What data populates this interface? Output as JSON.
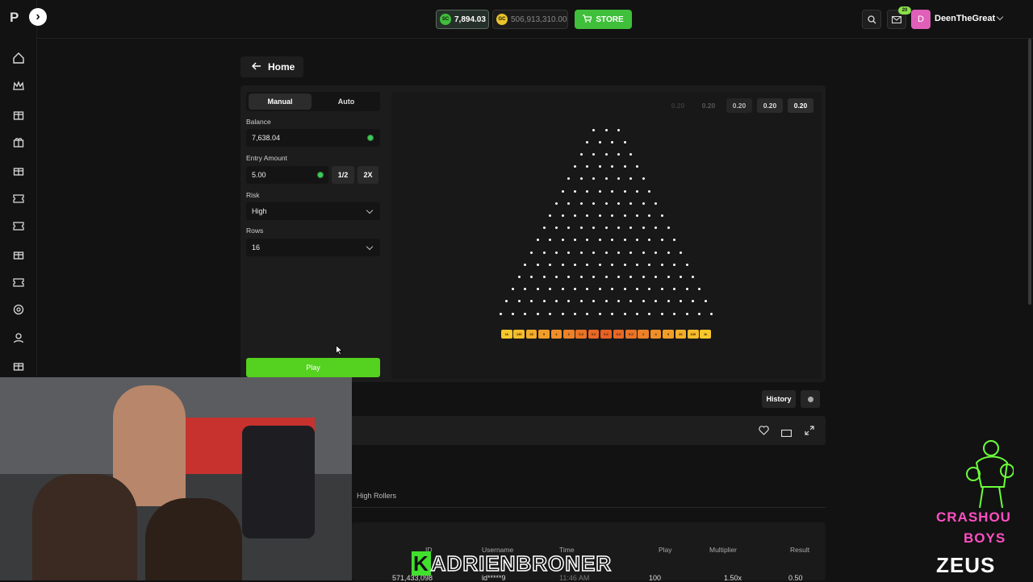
{
  "sidebar": {
    "logo": "P",
    "toggle": "›",
    "icons": [
      "home-icon",
      "crown-icon",
      "gift-box-icon",
      "gift-icon",
      "present-icon",
      "ticket-icon",
      "coupon-icon",
      "gift-card-icon",
      "voucher-icon",
      "support-icon",
      "user-icon",
      "rewards-icon"
    ]
  },
  "header": {
    "sc_label": "SC",
    "sc_value": "7,894.03",
    "gc_label": "GC",
    "gc_value": "506,913,310.00",
    "store_label": "STORE",
    "badge": "20",
    "avatar_letter": "D",
    "username": "DeenTheGreat"
  },
  "nav": {
    "home_label": "Home"
  },
  "controls": {
    "tab_manual": "Manual",
    "tab_auto": "Auto",
    "balance_label": "Balance",
    "balance_value": "7,638.04",
    "entry_label": "Entry Amount",
    "entry_value": "5.00",
    "half_label": "1/2",
    "double_label": "2X",
    "risk_label": "Risk",
    "risk_value": "High",
    "rows_label": "Rows",
    "rows_value": "16",
    "play_label": "Play"
  },
  "recent_results": [
    "0.20",
    "0.20",
    "0.20",
    "0.20",
    "0.20"
  ],
  "multipliers": [
    "1k",
    "130",
    "26",
    "9",
    "4",
    "2",
    "0.2",
    "0.2",
    "0.2",
    "0.2",
    "0.2",
    "2",
    "4",
    "9",
    "26",
    "130",
    "1k"
  ],
  "multiplier_colors": [
    "#f7c82c",
    "#f5bc2b",
    "#f3ad2a",
    "#f19e29",
    "#ee8f28",
    "#ec8127",
    "#ea7326",
    "#e86825",
    "#e66124",
    "#e86825",
    "#ea7326",
    "#ec8127",
    "#ee8f28",
    "#f19e29",
    "#f3ad2a",
    "#f5bc2b",
    "#f7c82c"
  ],
  "footer_buttons": {
    "history": "History"
  },
  "bets": {
    "tab": "High Rollers",
    "columns": [
      "ID",
      "Username",
      "Time",
      "Play",
      "Multiplier",
      "Result"
    ],
    "row": {
      "id": "571,433,098",
      "user": "ld*****9",
      "time": "11:46 AM",
      "play": "100",
      "multiplier": "1.50x",
      "result": "0.50"
    }
  },
  "overlay": {
    "name_first": "K",
    "name_rest": "ADRIENBRONER",
    "brand_line1": "CRASHOU",
    "brand_line2": "BOYS",
    "brand_logo": "ZEUS"
  },
  "colors": {
    "accent_green": "#55d11f",
    "store_green": "#3fbf3a",
    "avatar_pink": "#e05fb8",
    "brand_pink": "#ff4fc3"
  }
}
